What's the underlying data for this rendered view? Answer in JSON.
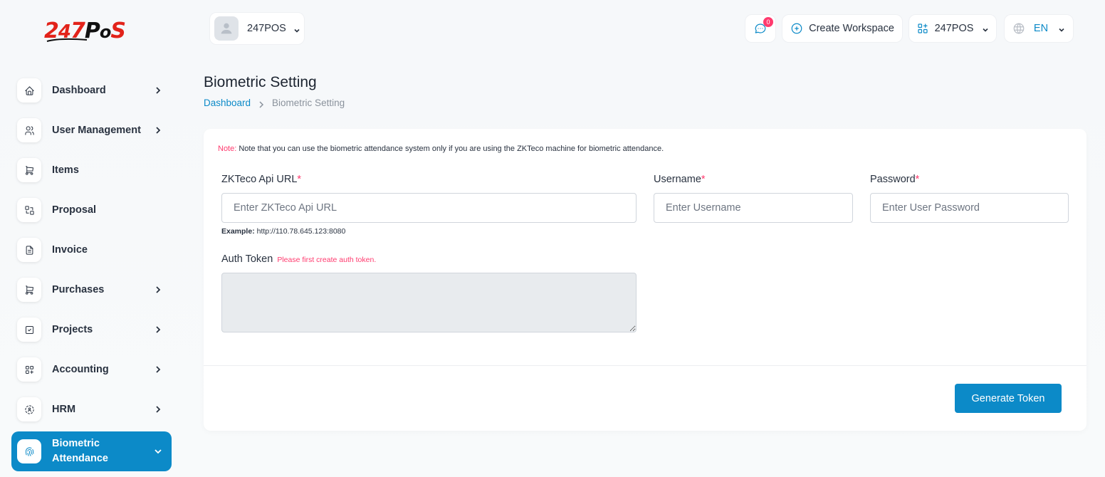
{
  "brand": {
    "logo_text": "247PoS"
  },
  "sidebar": {
    "items": [
      {
        "label": "Dashboard",
        "icon": "home-icon",
        "has_children": true
      },
      {
        "label": "User Management",
        "icon": "users-icon",
        "has_children": true
      },
      {
        "label": "Items",
        "icon": "cart-icon",
        "has_children": false
      },
      {
        "label": "Proposal",
        "icon": "exchange-icon",
        "has_children": false
      },
      {
        "label": "Invoice",
        "icon": "file-invoice-icon",
        "has_children": false
      },
      {
        "label": "Purchases",
        "icon": "cart-icon",
        "has_children": true
      },
      {
        "label": "Projects",
        "icon": "checkbox-icon",
        "has_children": true
      },
      {
        "label": "Accounting",
        "icon": "apps-plus-icon",
        "has_children": true
      },
      {
        "label": "HRM",
        "icon": "dashed-circle-icon",
        "has_children": true
      },
      {
        "label": "Biometric Attendance",
        "icon": "fingerprint-icon",
        "has_children": true,
        "active": true
      }
    ]
  },
  "header": {
    "workspace_name": "247POS",
    "message_count": "0",
    "create_workspace_label": "Create Workspace",
    "brand_switch_label": "247POS",
    "language": "EN"
  },
  "page": {
    "title": "Biometric Setting",
    "breadcrumb": {
      "home": "Dashboard",
      "current": "Biometric Setting"
    }
  },
  "form": {
    "note_label": "Note:",
    "note_text": "Note that you can use the biometric attendance system only if you are using the ZKTeco machine for biometric attendance.",
    "api_url_label": "ZKTeco Api URL",
    "api_url_placeholder": "Enter ZKTeco Api URL",
    "api_url_value": "",
    "example_label": "Example:",
    "example_value": "http://110.78.645.123:8080",
    "username_label": "Username",
    "username_placeholder": "Enter Username",
    "username_value": "",
    "password_label": "Password",
    "password_placeholder": "Enter User Password",
    "password_value": "",
    "required_mark": "*",
    "auth_token_label": "Auth Token",
    "auth_token_hint": "Please first create auth token.",
    "auth_token_value": "",
    "generate_button": "Generate Token"
  },
  "colors": {
    "primary": "#0c8ac8",
    "danger": "#ff3a6e",
    "text": "#293240",
    "background": "#f7f9fb"
  }
}
